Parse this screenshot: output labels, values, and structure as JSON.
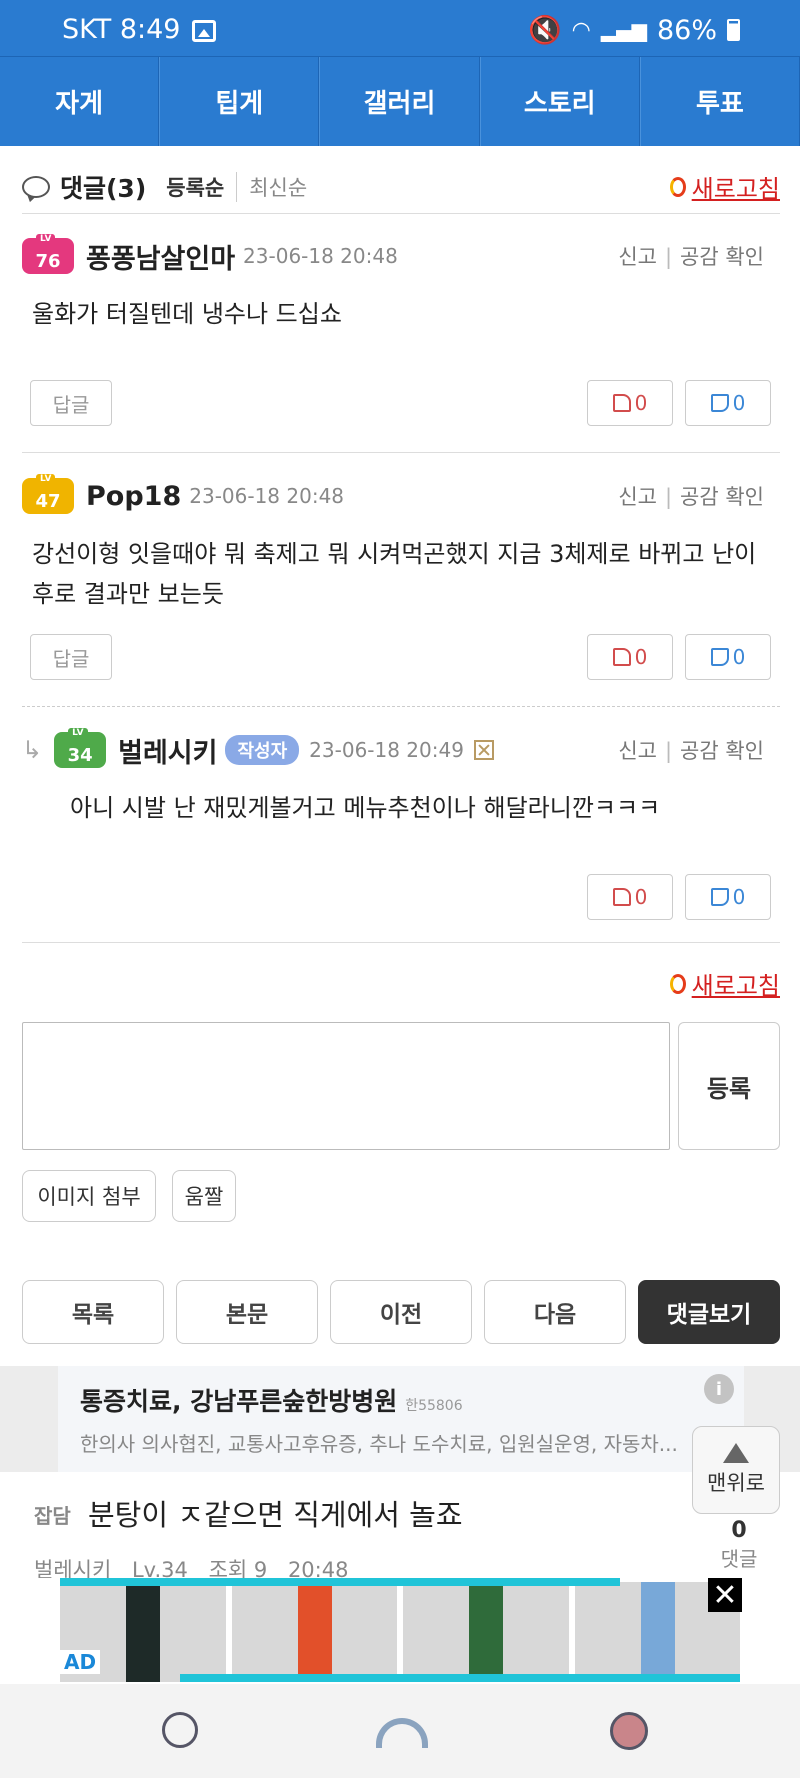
{
  "status": {
    "carrier_time": "SKT 8:49",
    "battery": "86%"
  },
  "nav": {
    "tabs": [
      "자게",
      "팁게",
      "갤러리",
      "스토리",
      "투표"
    ]
  },
  "comments_header": {
    "title": "댓글(3)",
    "sort_active": "등록순",
    "sort_other": "최신순",
    "refresh": "새로고침"
  },
  "comments": [
    {
      "level": "76",
      "nickname": "퐁퐁남살인마",
      "date": "23-06-18 20:48",
      "report": "신고",
      "empathy": "공감 확인",
      "text": "울화가 터질텐데 냉수나 드십쇼",
      "reply_label": "답글",
      "up": "0",
      "down": "0"
    },
    {
      "level": "47",
      "nickname": "Pop18",
      "date": "23-06-18 20:48",
      "report": "신고",
      "empathy": "공감 확인",
      "text": "강선이형 잇을때야 뭐 축제고 뭐 시켜먹곤했지 지금 3체제로 바뀌고 난이후로 결과만 보는듯",
      "reply_label": "답글",
      "up": "0",
      "down": "0"
    },
    {
      "level": "34",
      "nickname": "벌레시키",
      "author_tag": "작성자",
      "date": "23-06-18 20:49",
      "report": "신고",
      "empathy": "공감 확인",
      "text": "아니 시발 난 재밌게볼거고 메뉴추천이나 해달라니깐ㅋㅋㅋ",
      "up": "0",
      "down": "0"
    }
  ],
  "form": {
    "refresh": "새로고침",
    "register": "등록",
    "attach_image": "이미지 첨부",
    "gif": "움짤"
  },
  "bottom_nav": [
    "목록",
    "본문",
    "이전",
    "다음",
    "댓글보기"
  ],
  "ad": {
    "title": "통증치료, 강남푸른숲한방병원",
    "phone": "한55806",
    "desc": "한의사 의사협진, 교통사고후유증, 추나 도수치료, 입원실운영, 자동차..."
  },
  "top_button": "맨위로",
  "post": {
    "category": "잡담",
    "title": "분탕이 ㅈ같으면 직게에서 놀죠",
    "author": "벌레시키",
    "level": "Lv.34",
    "views": "조회 9",
    "time": "20:48",
    "comment_count": "0",
    "comment_label": "댓글"
  },
  "ad_bottom": {
    "tag": "AD",
    "close": "✕"
  }
}
